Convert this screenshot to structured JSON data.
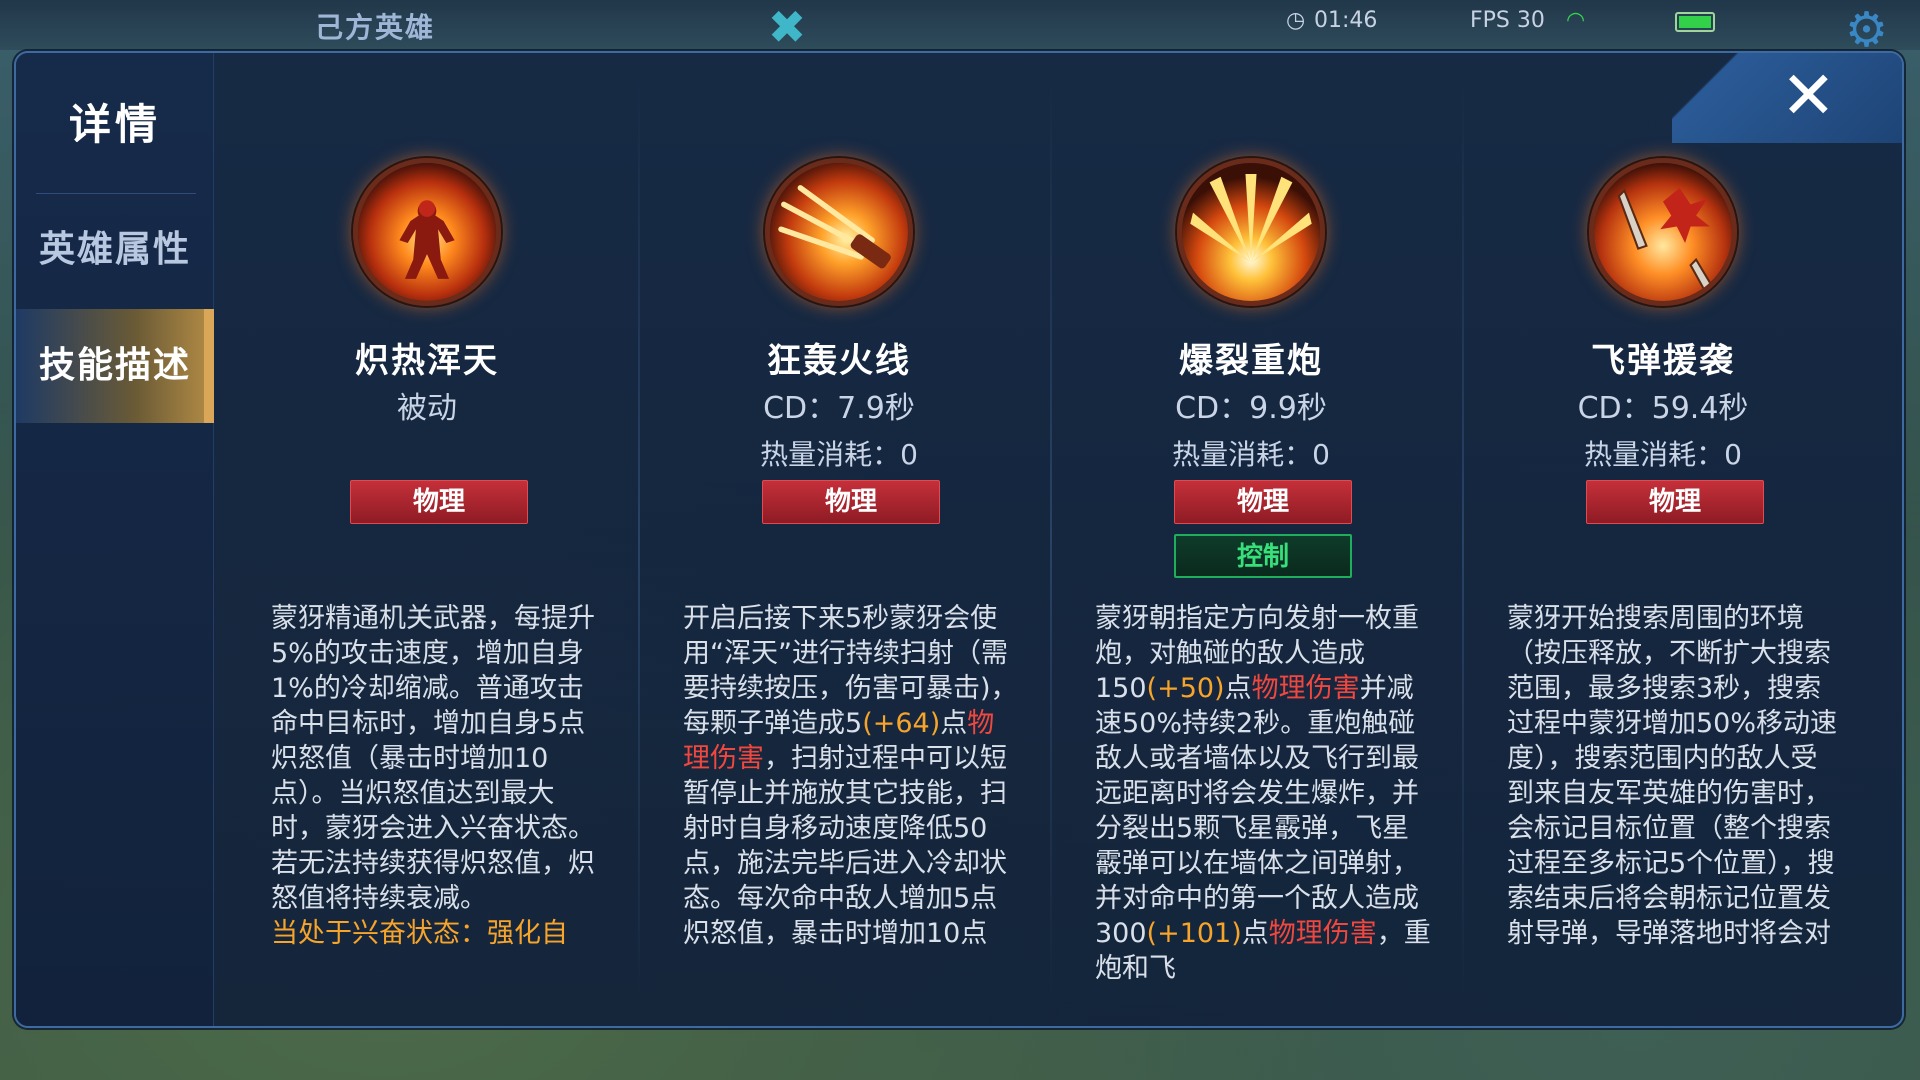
{
  "background": {
    "team_label": "己方英雄",
    "clock": "01:46",
    "fps": "FPS 30"
  },
  "sidebar": {
    "title": "详情",
    "items": [
      {
        "label": "英雄属性",
        "active": false
      },
      {
        "label": "技能描述",
        "active": true
      }
    ]
  },
  "close": {
    "label": "✕"
  },
  "skills": [
    {
      "name": "炽热浑天",
      "sub": "被动",
      "heat": "",
      "tags": [
        {
          "type": "phys",
          "label": "物理"
        }
      ],
      "desc": {
        "p1": "蒙犽精通机关武器，每提升5%的攻击速度，增加自身1%的冷却缩减。普通攻击命中目标时，增加自身5点炽怒值（暴击时增加10点）。当炽怒值达到最大时，蒙犽会进入兴奋状态。若无法持续获得炽怒值，炽怒值将持续衰减。",
        "p2": "当处于兴奋状态：强化自"
      }
    },
    {
      "name": "狂轰火线",
      "sub": "CD：7.9秒",
      "heat": "热量消耗：0",
      "tags": [
        {
          "type": "phys",
          "label": "物理"
        }
      ],
      "desc": {
        "t1": "开启后接下来5秒蒙犽会使用“浑天”进行持续扫射（需要持续按压，伤害可暴击)，每颗子弹造成5",
        "t2": "(+64)",
        "t3": "点",
        "t4": "物理伤害",
        "t5": "，扫射过程中可以短暂停止并施放其它技能，扫射时自身移动速度降低50点，施法完毕后进入冷却状态。每次命中敌人增加5点炽怒值，暴击时增加10点"
      }
    },
    {
      "name": "爆裂重炮",
      "sub": "CD：9.9秒",
      "heat": "热量消耗：0",
      "tags": [
        {
          "type": "phys",
          "label": "物理"
        },
        {
          "type": "ctrl",
          "label": "控制"
        }
      ],
      "desc": {
        "t1": "蒙犽朝指定方向发射一枚重炮，对触碰的敌人造成150",
        "t2": "(+50)",
        "t3": "点",
        "t4": "物理伤害",
        "t5": "并减速50%持续2秒。重炮触碰敌人或者墙体以及飞行到最远距离时将会发生爆炸，并分裂出5颗飞星霰弹，飞星霰弹可以在墙体之间弹射，并对命中的第一个敌人造成300",
        "t6": "(+101)",
        "t7": "点",
        "t8": "物理伤害",
        "t9": "，重炮和飞"
      }
    },
    {
      "name": "飞弹援袭",
      "sub": "CD：59.4秒",
      "heat": "热量消耗：0",
      "tags": [
        {
          "type": "phys",
          "label": "物理"
        }
      ],
      "desc": {
        "p1": "蒙犽开始搜索周围的环境（按压释放，不断扩大搜索范围，最多搜索3秒，搜索过程中蒙犽增加50%移动速度），搜索范围内的敌人受到来自友军英雄的伤害时，会标记目标位置（整个搜索过程至多标记5个位置），搜索结束后将会朝标记位置发射导弹，导弹落地时将会对"
      }
    }
  ]
}
